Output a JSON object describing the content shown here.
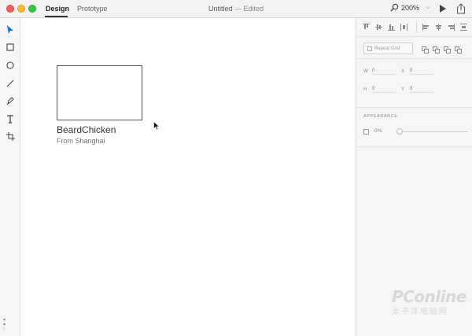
{
  "window": {
    "tabs": [
      {
        "label": "Design",
        "active": true
      },
      {
        "label": "Prototype",
        "active": false
      }
    ],
    "document_title": "Untitled",
    "document_status": "— Edited",
    "zoom_level": "200%",
    "icons": {
      "zoom": "search-icon",
      "zoom_dropdown": "chevron-down-icon",
      "play": "play-icon",
      "share": "share-icon"
    }
  },
  "toolbar": {
    "tools": [
      "select-tool",
      "rectangle-tool",
      "ellipse-tool",
      "line-tool",
      "pen-tool",
      "text-tool",
      "artboard-tool"
    ],
    "active_tool": "select-tool",
    "accent": "#1473e6"
  },
  "canvas": {
    "artboard_title": "BeardChicken",
    "artboard_subtitle": "From Shanghai"
  },
  "properties": {
    "repeat_grid_label": "Repeat Grid",
    "w_label": "W",
    "w_value": "0",
    "x_label": "X",
    "x_value": "0",
    "h_label": "H",
    "h_value": "0",
    "y_label": "Y",
    "y_value": "0",
    "appearance_title": "APPEARANCE",
    "opacity_value": "0%"
  },
  "watermark": {
    "text": "PConline",
    "subtitle": "太平洋电脑网"
  }
}
